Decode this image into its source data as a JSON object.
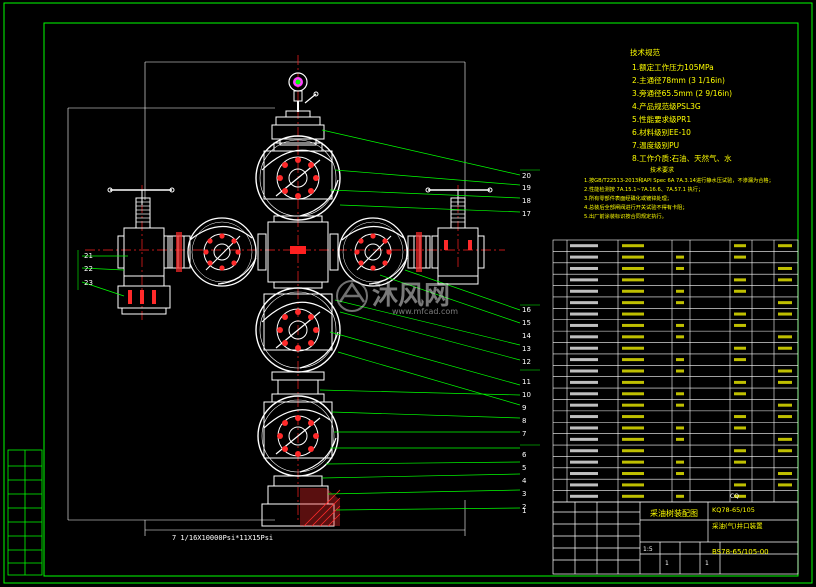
{
  "colors": {
    "background": "#000000",
    "frame": "#00ff00",
    "outline": "#ffffff",
    "centerline": "#ff2020",
    "dim": "#ff3030",
    "leader": "#00ff00",
    "table_line": "#ffffff",
    "table_text": "#ffff00",
    "note_text": "#ffff00",
    "accent_magenta": "#ff40ff",
    "accent_cyan": "#00ffff",
    "valve_red": "#ff2a2a"
  },
  "tech_notes": {
    "heading": "技术规范",
    "lines": [
      "1.额定工作压力105MPa",
      "2.主通径78mm (3 1/16in)",
      "3.旁通径65.5mm (2 9/16in)",
      "4.产品规范级PSL3G",
      "5.性能要求级PR1",
      "6.材料级别EE-10",
      "7.温度级别PU",
      "8.工作介质:石油、天然气、水"
    ]
  },
  "tech_requirements": {
    "heading": "技术要求",
    "lines": [
      "1.按GB/T22513-2013和API Spec 6A 7A.3.14进行静水压试验，不渗漏为合格；",
      "2.性能检测按 7A.15.1~7A.16.6、7A.57.1 执行；",
      "3.所有零部件表面经磷化或镀锌处理；",
      "4.总装后全部闸阀进行开关试验不得有卡阻；",
      "5.出厂前涂装标识按合同规定执行。"
    ]
  },
  "bottom_dim": "7 1/16X10000Psi*11X15Psi",
  "part_numbers_left": [
    "21",
    "22",
    "23"
  ],
  "part_numbers_right": [
    "20",
    "19",
    "18",
    "17",
    "16",
    "15",
    "14",
    "13",
    "12",
    "11",
    "10",
    "9",
    "8",
    "7",
    "6",
    "5",
    "4",
    "3",
    "2",
    "1"
  ],
  "title_block": {
    "drawing_title": "采油树装配图",
    "model": "KQ78-65/105",
    "subtitle": "采油(气)井口装置",
    "drawing_no": "BS78-65/105-00",
    "company_code": "CQ",
    "scale_label": "1:5",
    "sheet": "1",
    "sheets": "1"
  },
  "watermark": {
    "brand": "沐风网",
    "url": "www.mfcad.com"
  }
}
